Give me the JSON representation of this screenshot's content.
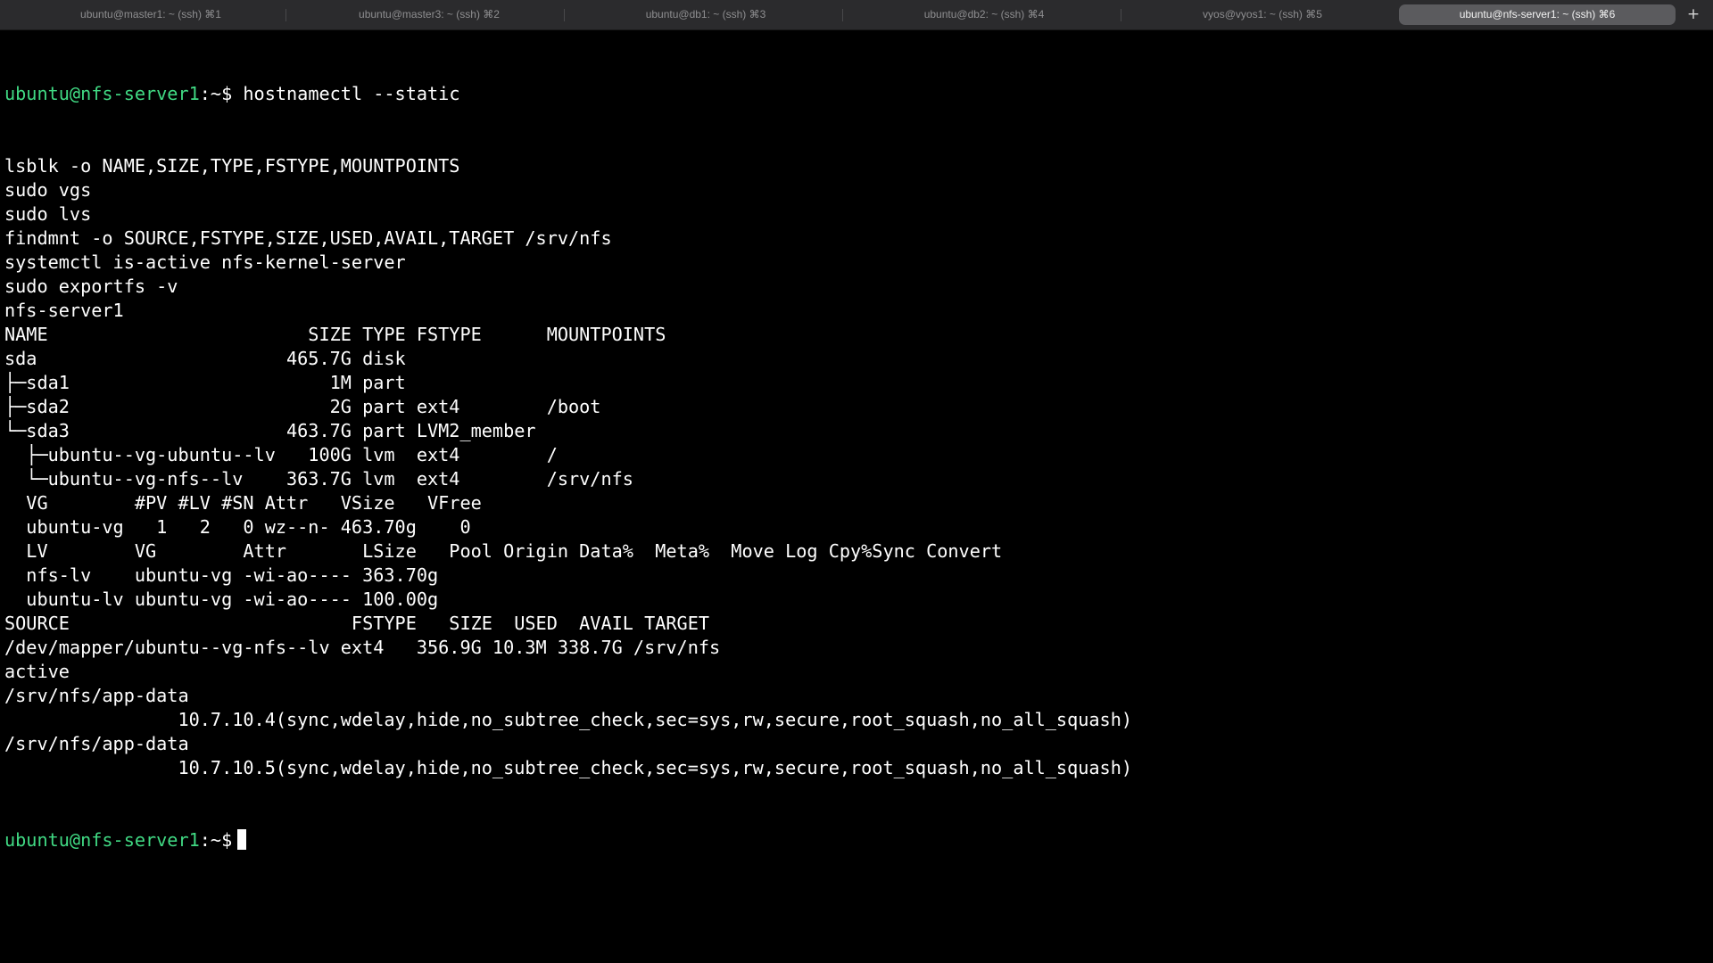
{
  "tabs": [
    {
      "label": "ubuntu@master1: ~ (ssh) ⌘1",
      "active": false
    },
    {
      "label": "ubuntu@master3: ~ (ssh) ⌘2",
      "active": false
    },
    {
      "label": "ubuntu@db1: ~ (ssh) ⌘3",
      "active": false
    },
    {
      "label": "ubuntu@db2: ~ (ssh) ⌘4",
      "active": false
    },
    {
      "label": "vyos@vyos1: ~ (ssh) ⌘5",
      "active": false
    },
    {
      "label": "ubuntu@nfs-server1: ~ (ssh) ⌘6",
      "active": true
    }
  ],
  "new_tab_label": "+",
  "colors": {
    "background": "#000000",
    "text": "#ffffff",
    "prompt": "#40d983",
    "tabbar": "#2b2b2d",
    "active_tab": "#5b5b5e"
  },
  "terminal": {
    "prompt_user": "ubuntu@nfs-server1",
    "prompt_tail": ":~$",
    "first_command": " hostnamectl --static",
    "output_lines": [
      "lsblk -o NAME,SIZE,TYPE,FSTYPE,MOUNTPOINTS",
      "sudo vgs",
      "sudo lvs",
      "findmnt -o SOURCE,FSTYPE,SIZE,USED,AVAIL,TARGET /srv/nfs",
      "systemctl is-active nfs-kernel-server",
      "sudo exportfs -v",
      "nfs-server1",
      "NAME                        SIZE TYPE FSTYPE      MOUNTPOINTS",
      "sda                       465.7G disk",
      "├─sda1                        1M part",
      "├─sda2                        2G part ext4        /boot",
      "└─sda3                    463.7G part LVM2_member",
      "  ├─ubuntu--vg-ubuntu--lv   100G lvm  ext4        /",
      "  └─ubuntu--vg-nfs--lv    363.7G lvm  ext4        /srv/nfs",
      "  VG        #PV #LV #SN Attr   VSize   VFree",
      "  ubuntu-vg   1   2   0 wz--n- 463.70g    0",
      "  LV        VG        Attr       LSize   Pool Origin Data%  Meta%  Move Log Cpy%Sync Convert",
      "  nfs-lv    ubuntu-vg -wi-ao---- 363.70g",
      "  ubuntu-lv ubuntu-vg -wi-ao---- 100.00g",
      "SOURCE                          FSTYPE   SIZE  USED  AVAIL TARGET",
      "/dev/mapper/ubuntu--vg-nfs--lv ext4   356.9G 10.3M 338.7G /srv/nfs",
      "active",
      "/srv/nfs/app-data",
      "                10.7.10.4(sync,wdelay,hide,no_subtree_check,sec=sys,rw,secure,root_squash,no_all_squash)",
      "/srv/nfs/app-data",
      "                10.7.10.5(sync,wdelay,hide,no_subtree_check,sec=sys,rw,secure,root_squash,no_all_squash)"
    ]
  }
}
